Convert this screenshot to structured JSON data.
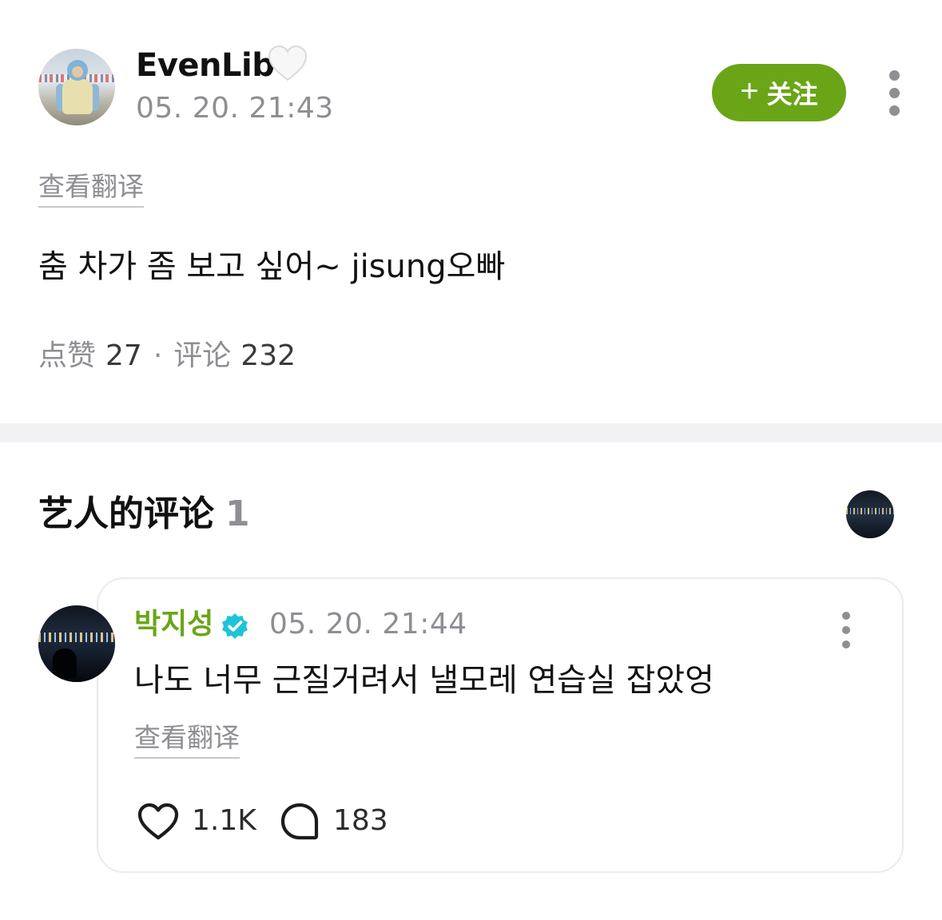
{
  "post": {
    "author": "EvenLib",
    "time": "05. 20. 21:43",
    "follow_label": "关注",
    "follow_icon": "plus-icon",
    "translate_label": "查看翻译",
    "body": "춤 차가 좀 보고 싶어~ jisung오빠",
    "likes_label": "点赞",
    "likes": "27",
    "separator": "·",
    "comments_label": "评论",
    "comments": "232"
  },
  "artist_comments": {
    "title": "艺人的评论",
    "count": "1",
    "comment": {
      "author": "박지성",
      "time": "05. 20. 21:44",
      "body": "나도 너무 근질거려서 낼모레 연습실 잡았엉",
      "translate_label": "查看翻译",
      "likes": "1.1K",
      "replies": "183"
    }
  },
  "colors": {
    "accent_green": "#6aa518",
    "muted_text": "#8e8e93",
    "verified_blue": "#1fc3d8",
    "divider": "#f2f2f4"
  },
  "icons": [
    "heart-emoji-icon",
    "kebab-menu-icon",
    "verified-badge-icon",
    "heart-icon",
    "comment-bubble-icon"
  ]
}
